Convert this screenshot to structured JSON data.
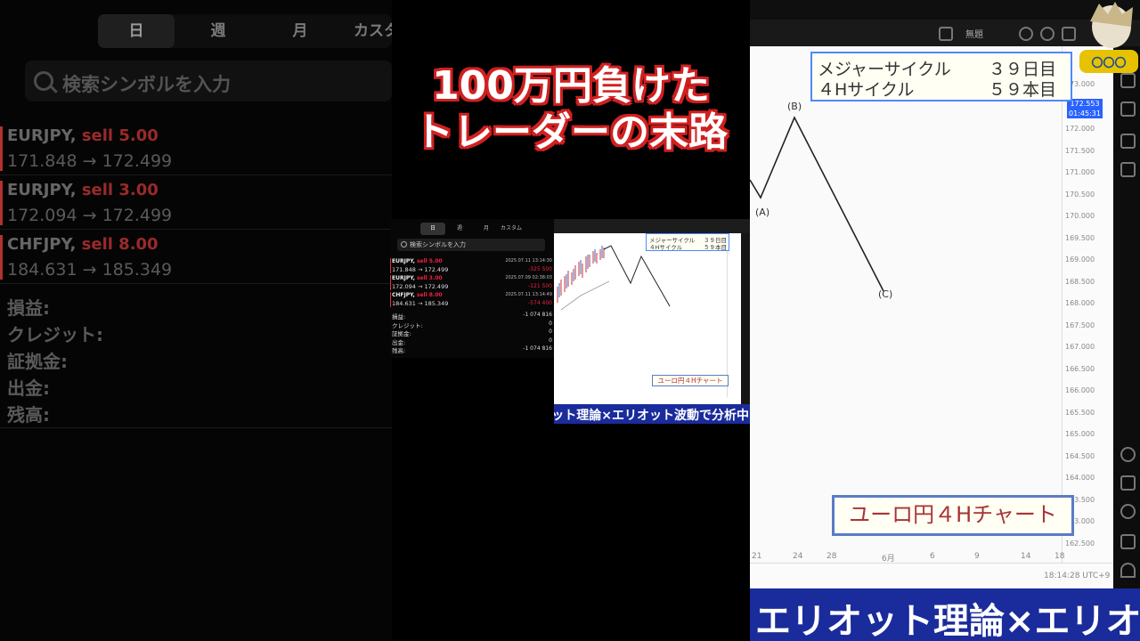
{
  "title": {
    "line1": "100万円負けた",
    "line2": "トレーダーの末路"
  },
  "history": {
    "tabs": [
      "日",
      "週",
      "月",
      "カスタム"
    ],
    "search_placeholder": "検索シンボルを入力",
    "trades": [
      {
        "symbol": "EURJPY,",
        "side": "sell 5.00",
        "prices": "171.848 → 172.499",
        "datetime": "2025.07.11 13:14:30",
        "pl": "-325 500"
      },
      {
        "symbol": "EURJPY,",
        "side": "sell 3.00",
        "prices": "172.094 → 172.499",
        "datetime": "2025.07.09 02:38:03",
        "pl": "-121 500"
      },
      {
        "symbol": "CHFJPY,",
        "side": "sell 8.00",
        "prices": "184.631 → 185.349",
        "datetime": "2025.07.11 13:14:49",
        "pl": "-574 400"
      }
    ],
    "summary": [
      {
        "label": "損益:",
        "value": "-1 074 816"
      },
      {
        "label": "クレジット:",
        "value": "0"
      },
      {
        "label": "証拠金:",
        "value": "0"
      },
      {
        "label": "出金:",
        "value": "0"
      },
      {
        "label": "残高:",
        "value": "-1 074 816"
      }
    ]
  },
  "chart": {
    "info_line1_label": "メジャーサイクル",
    "info_line1_value": "３９日目",
    "info_line2_label": "４Hサイクル",
    "info_line2_value": "５９本目",
    "chart_label": "ユーロ円４Hチャート",
    "y_ticks": [
      "172.000",
      "171.500",
      "171.000",
      "170.500",
      "170.000",
      "169.500",
      "169.000",
      "168.500",
      "168.000",
      "167.500",
      "167.000",
      "166.500",
      "166.000",
      "165.500",
      "165.000",
      "164.500",
      "164.000",
      "163.500",
      "163.000",
      "162.500"
    ],
    "top_tick": "173.000",
    "price_tag": "172.553",
    "price_tag_sub": "01:45:31",
    "x_ticks": [
      "21",
      "24",
      "28",
      "6月",
      "6",
      "9",
      "14",
      "18"
    ],
    "time": "18:14:28 UTC+9",
    "toolbar_label": "無題",
    "wave_labels": [
      "(A)",
      "(B)",
      "(C)"
    ]
  },
  "banner": {
    "text": "エリオット理論×エリオット波動で分析中"
  },
  "colors": {
    "title_outline": "#d02020",
    "banner_bg": "#1a2b9b",
    "sell_red": "#e22b40",
    "info_border": "#4d88ff"
  }
}
